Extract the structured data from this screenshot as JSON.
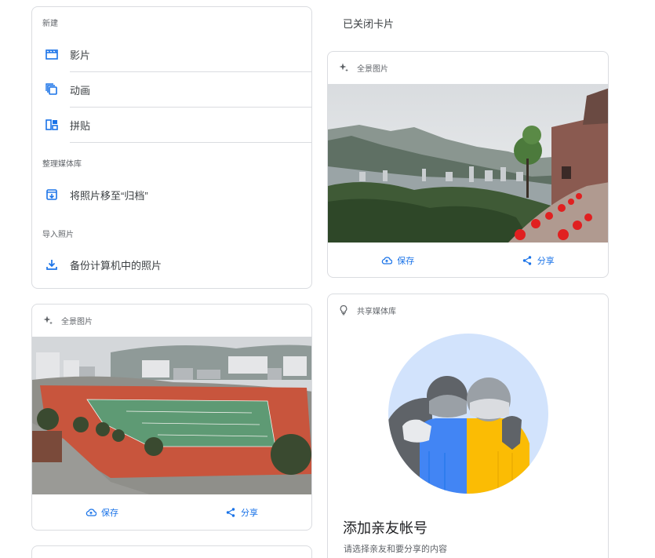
{
  "create": {
    "section_new": "新建",
    "items_new": [
      {
        "label": "影片",
        "icon": "movie-icon"
      },
      {
        "label": "动画",
        "icon": "animation-icon"
      },
      {
        "label": "拼贴",
        "icon": "collage-icon"
      }
    ],
    "section_organize": "整理媒体库",
    "archive_label": "将照片移至“归档”",
    "section_import": "导入照片",
    "backup_label": "备份计算机中的照片"
  },
  "closed_cards_label": "已关闭卡片",
  "pano_card_right": {
    "title": "全景图片",
    "save_label": "保存",
    "share_label": "分享"
  },
  "pano_card_left": {
    "title": "全景图片",
    "save_label": "保存",
    "share_label": "分享"
  },
  "shared_library": {
    "title": "共享媒体库",
    "heading": "添加亲友帐号",
    "description": "请选择亲友和要分享的内容"
  },
  "colors": {
    "accent": "#1a73e8",
    "border": "#dadce0",
    "illustration_bg": "#d2e3fc",
    "blue": "#4285f4",
    "yellow": "#fbbc04",
    "gray": "#5f6368"
  }
}
